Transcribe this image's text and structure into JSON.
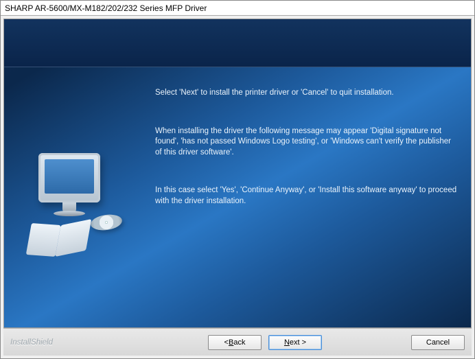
{
  "window": {
    "title": "SHARP AR-5600/MX-M182/202/232 Series MFP Driver"
  },
  "content": {
    "instruction": "Select 'Next' to install the printer driver or 'Cancel' to quit installation.",
    "warning": "When installing the driver the following message may appear 'Digital signature not found', 'has not passed Windows Logo testing', or 'Windows can't verify the publisher of this driver software'.",
    "proceed": "In this case select 'Yes', 'Continue Anyway', or 'Install this software anyway' to proceed with the driver installation."
  },
  "footer": {
    "brand": "InstallShield",
    "back_prefix": "< ",
    "back_char": "B",
    "back_rest": "ack",
    "next_char": "N",
    "next_rest": "ext >",
    "cancel": "Cancel"
  }
}
